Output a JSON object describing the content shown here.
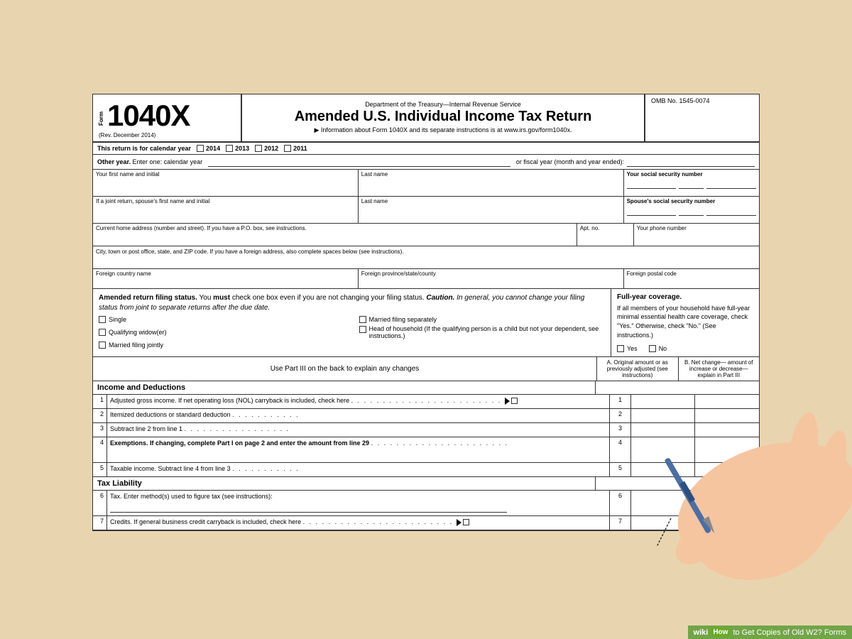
{
  "page": {
    "background_color": "#e8d5b0"
  },
  "form": {
    "agency": "Department of the Treasury—Internal Revenue Service",
    "form_label": "Form",
    "form_number": "1040X",
    "rev": "(Rev. December 2014)",
    "main_title": "Amended U.S. Individual Income Tax Return",
    "subtitle": "▶ Information about Form 1040X and its separate instructions is at www.irs.gov/form1040x.",
    "omb": "OMB No. 1545-0074",
    "calendar_year_label": "This return is for calendar year",
    "year_2014": "2014",
    "year_2013": "2013",
    "year_2012": "2012",
    "year_2011": "2011",
    "other_year_label": "Other year.",
    "other_year_text": "Enter one: calendar year",
    "fiscal_label": "or fiscal year (month and year ended):",
    "first_name_label": "Your first name and initial",
    "last_name_label": "Last name",
    "ssn_label": "Your social security number",
    "spouse_first_label": "If a joint return, spouse's first name and initial",
    "spouse_last_label": "Last name",
    "spouse_ssn_label": "Spouse's social security number",
    "address_label": "Current home address (number and street). If you have a P.O. box, see instructions.",
    "apt_label": "Apt. no.",
    "phone_label": "Your phone number",
    "city_label": "City, town or post office, state, and ZIP code.  If you have a foreign address, also complete spaces below (see instructions).",
    "foreign_country_label": "Foreign country name",
    "foreign_province_label": "Foreign province/state/county",
    "foreign_postal_label": "Foreign postal code",
    "filing_status_title": "Amended return filing status.",
    "filing_status_text1": " You must check one box even if you are not changing your filing status.",
    "filing_caution": " Caution.",
    "filing_caution_text": " In general, you cannot change your filing status from joint to separate returns after the due date.",
    "single_label": "Single",
    "qualifying_widow_label": "Qualifying widow(er)",
    "married_jointly_label": "Married filing jointly",
    "married_separately_label": "Married filing separately",
    "head_household_label": "Head of household (If the qualifying person is a child but not your dependent, see instructions.)",
    "coverage_title": "Full-year coverage.",
    "coverage_text": "If all members of your household have full-year minimal essential health care coverage, check \"Yes.\" Otherwise, check \"No.\" (See instructions.)",
    "yes_label": "Yes",
    "no_label": "No",
    "part_iii_notice": "Use Part III on the back to explain any changes",
    "col_a_header": "A. Original amount or as previously adjusted (see instructions)",
    "col_b_header": "B. Net change— amount of increase or decrease— explain in Part III",
    "income_header": "Income and Deductions",
    "line1_num": "1",
    "line1_desc": "Adjusted gross income. If net operating loss (NOL) carryback is included, check here  .  .  .  .  .  .  .  .  .  .  .  .  .  .  .  .  .  .  .  .  .  .  .  .",
    "line1_ref": "1",
    "line2_num": "2",
    "line2_desc": "Itemized deductions or standard deduction  .  .  .  .  .  .  .  .  .  .  .",
    "line2_ref": "2",
    "line3_num": "3",
    "line3_desc": "Subtract line 2 from line 1  .  .  .  .  .  .  .  .  .  .  .  .  .  .  .  .  .",
    "line3_ref": "3",
    "line4_num": "4",
    "line4_desc": "Exemptions. If changing, complete Part I on page 2 and enter the amount from line 29  .  .  .  .  .  .  .  .  .  .  .  .  .  .  .  .  .  .  .  .  .  .",
    "line4_ref": "4",
    "line5_num": "5",
    "line5_desc": "Taxable income. Subtract line 4 from line 3 .  .  .  .  .  .  .  .  .  .  .",
    "line5_ref": "5",
    "tax_liability_header": "Tax Liability",
    "line6_num": "6",
    "line6_desc": "Tax. Enter method(s) used to figure tax (see instructions):",
    "line6_ref": "6",
    "line7_num": "7",
    "line7_desc": "Credits. If general business credit carryback is included, check here  .  .  .  .  .  .  .  .  .  .  .  .  .  .  .  .  .  .  .  .  .  .  .  .",
    "line7_ref": "7",
    "wikihow_wiki": "wiki",
    "wikihow_how": "How",
    "wikihow_text": "to Get Copies of Old W2? Forms"
  }
}
